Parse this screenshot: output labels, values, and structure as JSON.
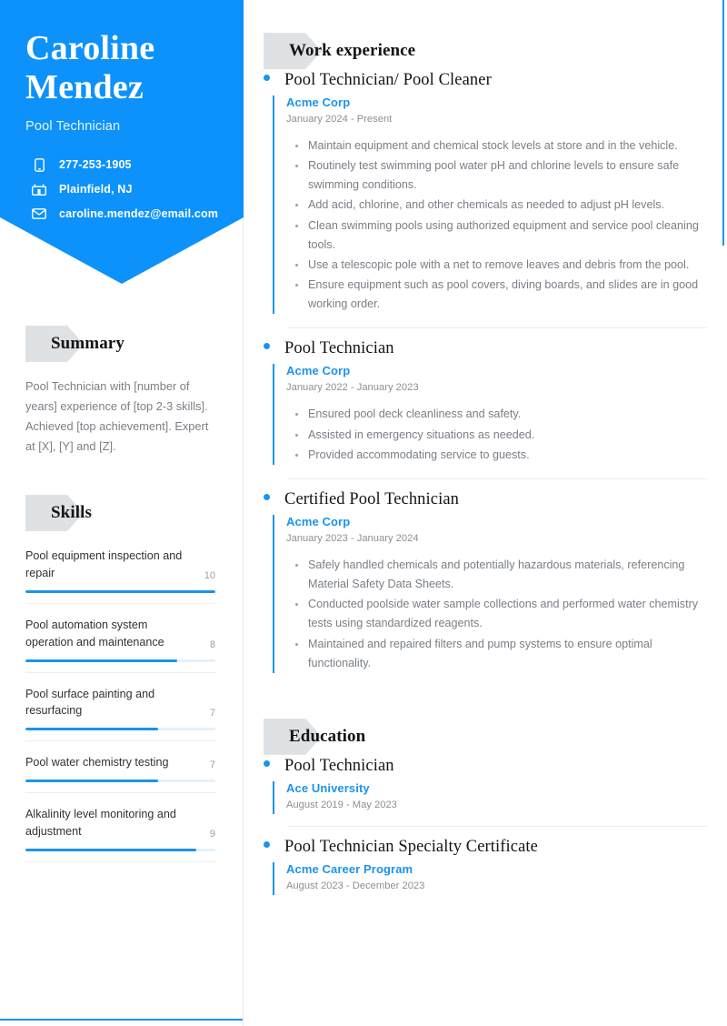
{
  "theme": {
    "accent": "#1a94ec",
    "banner": "#0c92fa",
    "badge_gray": "#dfe2e4",
    "muted_text": "#7b7f86",
    "heading_text": "#141414"
  },
  "sidebar": {
    "name": "Caroline Mendez",
    "job_title": "Pool Technician",
    "contacts": [
      {
        "icon": "phone-icon",
        "value": "277-253-1905"
      },
      {
        "icon": "location-icon",
        "value": "Plainfield, NJ"
      },
      {
        "icon": "email-icon",
        "value": "caroline.mendez@email.com"
      }
    ],
    "summary": {
      "heading": "Summary",
      "text": "Pool Technician with [number of years] experience of [top 2-3 skills]. Achieved [top achievement]. Expert at [X], [Y] and [Z]."
    },
    "skills": {
      "heading": "Skills",
      "max": 10,
      "items": [
        {
          "name": "Pool equipment inspection and repair",
          "score": "10",
          "value": 10
        },
        {
          "name": "Pool automation system operation and maintenance",
          "score": "8",
          "value": 8
        },
        {
          "name": "Pool surface painting and resurfacing",
          "score": "7",
          "value": 7
        },
        {
          "name": "Pool water chemistry testing",
          "score": "7",
          "value": 7
        },
        {
          "name": "Alkalinity level monitoring and adjustment",
          "score": "9",
          "value": 9
        }
      ]
    }
  },
  "main": {
    "work": {
      "heading": "Work experience",
      "entries": [
        {
          "title": "Pool Technician/ Pool Cleaner",
          "org": "Acme Corp",
          "dates": "January 2024 - Present",
          "duties": [
            "Maintain equipment and chemical stock levels at store and in the vehicle.",
            "Routinely test swimming pool water pH and chlorine levels to ensure safe swimming conditions.",
            "Add acid, chlorine, and other chemicals as needed to adjust pH levels.",
            "Clean swimming pools using authorized equipment and service pool cleaning tools.",
            "Use a telescopic pole with a net to remove leaves and debris from the pool.",
            "Ensure equipment such as pool covers, diving boards, and slides are in good working order."
          ]
        },
        {
          "title": "Pool Technician",
          "org": "Acme Corp",
          "dates": "January 2022 - January 2023",
          "duties": [
            "Ensured pool deck cleanliness and safety.",
            "Assisted in emergency situations as needed.",
            "Provided accommodating service to guests."
          ]
        },
        {
          "title": "Certified Pool Technician",
          "org": "Acme Corp",
          "dates": "January 2023 - January 2024",
          "duties": [
            "Safely handled chemicals and potentially hazardous materials, referencing Material Safety Data Sheets.",
            "Conducted poolside water sample collections and performed water chemistry tests using standardized reagents.",
            "Maintained and repaired filters and pump systems to ensure optimal functionality."
          ]
        }
      ]
    },
    "education": {
      "heading": "Education",
      "entries": [
        {
          "title": "Pool Technician",
          "org": "Ace University",
          "dates": "August 2019 - May 2023"
        },
        {
          "title": "Pool Technician Specialty Certificate",
          "org": "Acme Career Program",
          "dates": "August 2023 - December 2023"
        }
      ]
    }
  }
}
